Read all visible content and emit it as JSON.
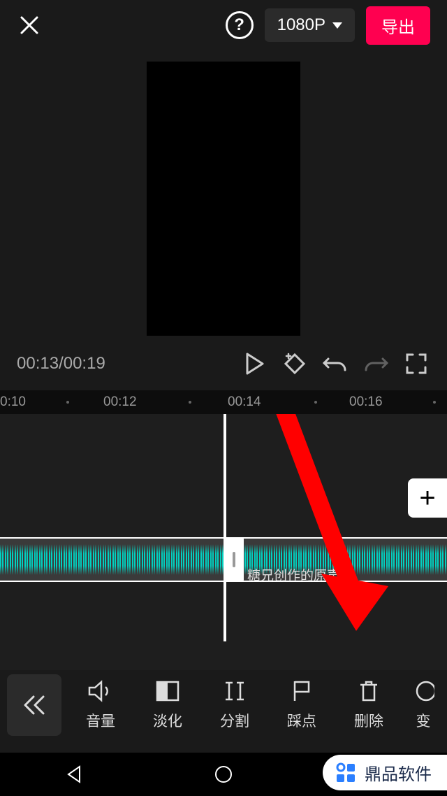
{
  "header": {
    "resolution": "1080P",
    "export_label": "导出"
  },
  "playback": {
    "current_time": "00:13",
    "total_time": "00:19"
  },
  "ruler": {
    "marks": [
      "0:10",
      "00:12",
      "00:14",
      "00:16"
    ]
  },
  "timeline": {
    "clip_label": "糖兄创作的原声"
  },
  "toolbar": {
    "volume": "音量",
    "fade": "淡化",
    "split": "分割",
    "beat": "踩点",
    "delete": "删除",
    "change": "变"
  },
  "brand": {
    "name": "鼎品软件"
  }
}
